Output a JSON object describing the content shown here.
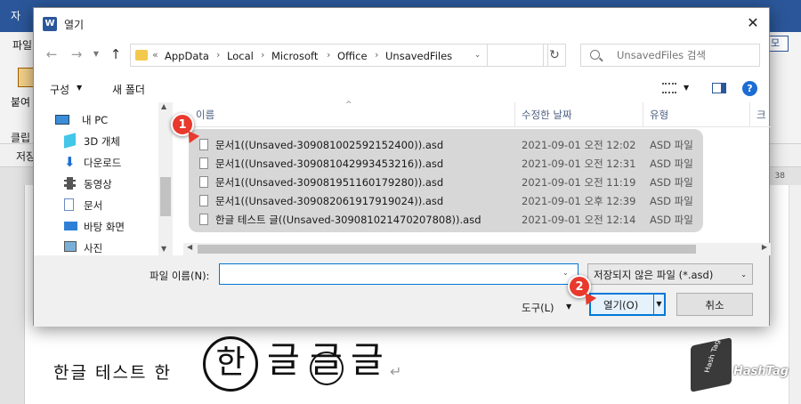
{
  "background_app": {
    "title": "자",
    "tab_file": "파일",
    "user_initials": "모",
    "paste_label": "붙여",
    "clipboard_label": "클립",
    "save_label": "저장",
    "ruler_number": "38",
    "doc_text": "한글 테스트 한",
    "doc_han": "한",
    "doc_geul": "글",
    "return_mark": "↵",
    "logo_text": "HashTag",
    "logo_cube_text": "Hash Tag"
  },
  "dialog": {
    "title": "열기",
    "app_icon_letter": "W",
    "close_icon": "close-icon"
  },
  "address": {
    "overflow": "«",
    "crumbs": [
      "AppData",
      "Local",
      "Microsoft",
      "Office",
      "UnsavedFiles"
    ],
    "separator": "›"
  },
  "search": {
    "placeholder": "UnsavedFiles 검색"
  },
  "toolbar": {
    "organize": "구성",
    "new_folder": "새 폴더",
    "help": "?"
  },
  "nav_pane": {
    "items": [
      {
        "label": "내 PC",
        "icon": "pc-icon"
      },
      {
        "label": "3D 개체",
        "icon": "cube-icon"
      },
      {
        "label": "다운로드",
        "icon": "download-icon"
      },
      {
        "label": "동영상",
        "icon": "video-icon"
      },
      {
        "label": "문서",
        "icon": "document-icon"
      },
      {
        "label": "바탕 화면",
        "icon": "desktop-icon"
      },
      {
        "label": "사진",
        "icon": "picture-icon"
      }
    ]
  },
  "columns": {
    "name": "이름",
    "date": "수정한 날짜",
    "type": "유형",
    "size": "크"
  },
  "files": [
    {
      "name": "문서1((Unsaved-309081002592152400)).asd",
      "date": "2021-09-01 오전 12:02",
      "type": "ASD 파일"
    },
    {
      "name": "문서1((Unsaved-309081042993453216)).asd",
      "date": "2021-09-01 오전 12:31",
      "type": "ASD 파일"
    },
    {
      "name": "문서1((Unsaved-309081951160179280)).asd",
      "date": "2021-09-01 오전 11:19",
      "type": "ASD 파일"
    },
    {
      "name": "문서1((Unsaved-309082061917919024)).asd",
      "date": "2021-09-01 오후 12:39",
      "type": "ASD 파일"
    },
    {
      "name": "한글 테스트  글((Unsaved-309081021470207808)).asd",
      "date": "2021-09-01 오전 12:14",
      "type": "ASD 파일"
    }
  ],
  "bottom": {
    "filename_label": "파일 이름(N):",
    "filename_value": "",
    "filetype": "저장되지 않은 파일 (*.asd)",
    "tools": "도구(L)",
    "open": "열기(O)",
    "cancel": "취소"
  },
  "badges": [
    "1",
    "2"
  ],
  "colors": {
    "accent": "#0078d7",
    "badge": "#e8392c",
    "word_blue": "#2b579a"
  }
}
